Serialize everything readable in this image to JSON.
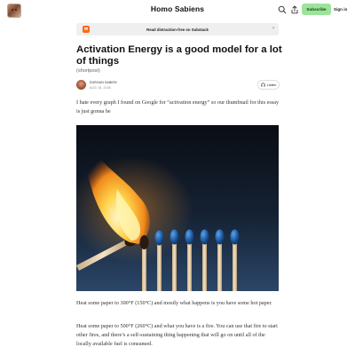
{
  "header": {
    "site_title": "Homo Sabiens",
    "subscribe_label": "Subscribe",
    "signin_label": "Sign in",
    "icons": [
      "search-icon",
      "share-icon"
    ]
  },
  "banner": {
    "text": "Read distraction-free on Substack",
    "icon": "substack-icon",
    "chevron": "›"
  },
  "post": {
    "title": "Activation Energy is a good model for a lot of things",
    "subtitle": "(shortpost)",
    "author": "DURGAN SABIEN",
    "date": "AUG 16, 2025",
    "listen_label": "Listen",
    "paragraphs": [
      "I hate every graph I found on Google for “activation energy” so our thumbnail for this essay is just gonna be",
      "Heat some paper to 300°F (150°C) and mostly what happens is you have some hot paper.",
      "Heat some paper to 500°F (260°C) and what you have is a fire. You can use that fire to start other fires, and there’s a self-sustaining thing happening that will go on until all of the locally available fuel is consumed."
    ],
    "hero_image": "match-igniting-row-of-matches"
  },
  "colors": {
    "subscribe_bg": "#9de39b",
    "banner_bg": "#efefef",
    "substack_orange": "#ff6719",
    "match_head_blue": "#1f5fa8"
  }
}
